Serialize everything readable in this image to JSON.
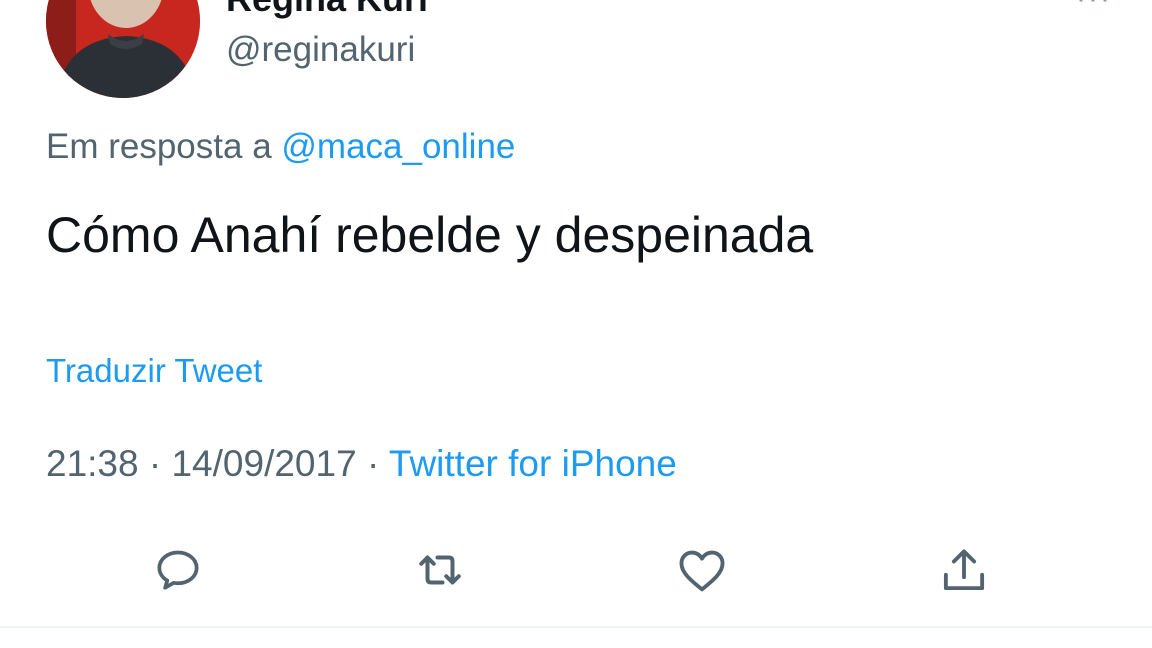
{
  "user": {
    "display_name": "Regina Kuri",
    "handle": "@reginakuri"
  },
  "reply": {
    "prefix": "Em resposta a",
    "mention": "@maca_online"
  },
  "tweet": {
    "text": "Cómo Anahí rebelde y despeinada",
    "translate_label": "Traduzir Tweet",
    "time": "21:38",
    "separator": "·",
    "date": "14/09/2017",
    "source": "Twitter for iPhone"
  },
  "actions": {
    "icons": [
      "reply-icon",
      "retweet-icon",
      "like-icon",
      "share-icon"
    ]
  },
  "colors": {
    "link": "#1d9bf0",
    "text": "#0f1419",
    "secondary": "#536471",
    "avatar_bg": "#c7271f"
  }
}
